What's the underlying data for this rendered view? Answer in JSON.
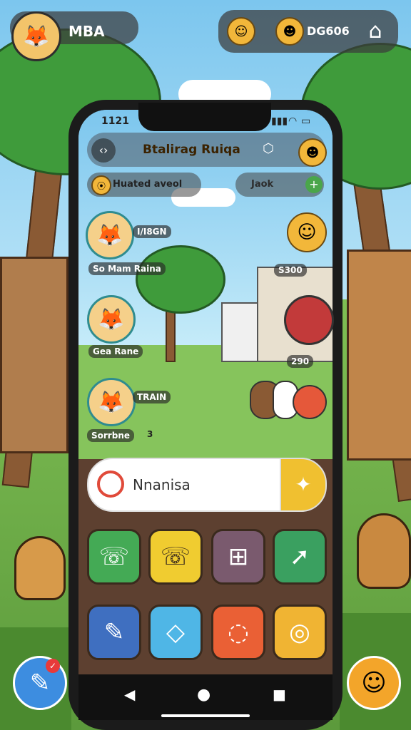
{
  "topbar": {
    "player_name": "MBA",
    "coin_value": "DG606",
    "avatar_icon": "fox-avatar-icon",
    "home_icon": "home-icon"
  },
  "phone": {
    "status": {
      "time": "1121",
      "signal": "▮▮▮",
      "wifi": "◠",
      "battery": "▭"
    },
    "header": {
      "title": "Btalirag Ruiqa",
      "left_icon": "back-icon"
    },
    "chips": {
      "left": "Huated aveol",
      "right": "Jaok"
    },
    "friends": [
      {
        "name": "I/I8GN",
        "subtitle": "So Mam Raina"
      },
      {
        "name": "Gea Rane",
        "subtitle": ""
      },
      {
        "name": "TRAIN",
        "subtitle": "Sorrbne"
      }
    ],
    "friend_badge": "3",
    "right_counters": [
      {
        "value": "S300"
      },
      {
        "value": "290"
      }
    ],
    "search": {
      "text": "Nnanisa"
    },
    "apps": [
      {
        "name": "phone-green",
        "color": "#44aa55",
        "icon": "☏"
      },
      {
        "name": "phone-yellow",
        "color": "#f0cc30",
        "icon": "☏"
      },
      {
        "name": "grid-purple",
        "color": "#7a5a6e",
        "icon": "⊞"
      },
      {
        "name": "share-green",
        "color": "#3aa060",
        "icon": "➚"
      },
      {
        "name": "broom-blue",
        "color": "#3f6fc0",
        "icon": "✎"
      },
      {
        "name": "box-cyan",
        "color": "#4fb6e6",
        "icon": "◇"
      },
      {
        "name": "chat-orange",
        "color": "#ea6035",
        "icon": "◌"
      },
      {
        "name": "camera-yellow",
        "color": "#f0b433",
        "icon": "◎"
      }
    ],
    "nav": {
      "back": "◀",
      "home": "●",
      "recent": "■"
    }
  },
  "fab_left_badge": "✓"
}
